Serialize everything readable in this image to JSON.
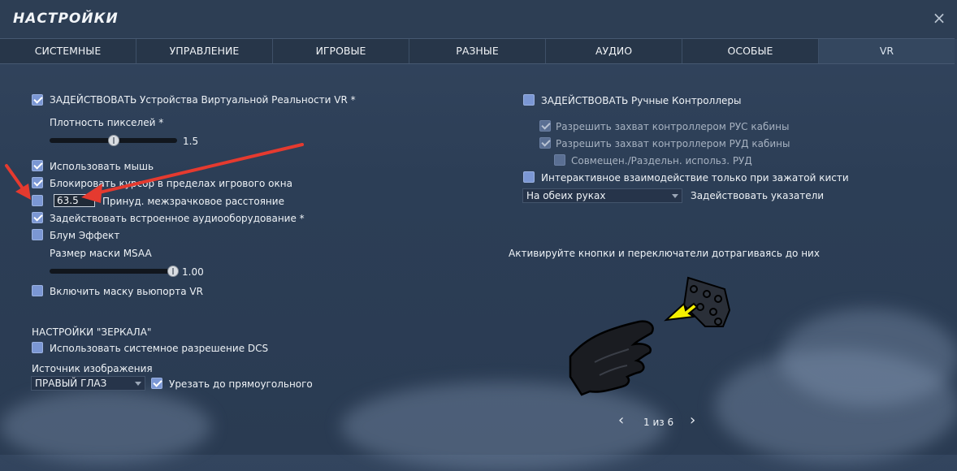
{
  "window": {
    "title": "НАСТРОЙКИ",
    "close_glyph": "×"
  },
  "tabs": [
    {
      "label": "СИСТЕМНЫЕ"
    },
    {
      "label": "УПРАВЛЕНИЕ"
    },
    {
      "label": "ИГРОВЫЕ"
    },
    {
      "label": "РАЗНЫЕ"
    },
    {
      "label": "АУДИО"
    },
    {
      "label": "ОСОБЫЕ"
    },
    {
      "label": "VR"
    }
  ],
  "active_tab": "VR",
  "left": {
    "enable_vr": {
      "label": "ЗАДЕЙСТВОВАТЬ Устройства Виртуальной Реальности VR *",
      "checked": true
    },
    "pixel_density": {
      "label": "Плотность пикселей *",
      "value": "1.5",
      "level": 0.5
    },
    "use_mouse": {
      "label": "Использовать мышь",
      "checked": true
    },
    "lock_cursor": {
      "label": "Блокировать курсор в пределах игрового окна",
      "checked": true
    },
    "ipd": {
      "value": "63.5",
      "label": "Принуд. межзрачковое расстояние",
      "checked": false
    },
    "builtin_audio": {
      "label": "Задействовать встроенное аудиооборудование *",
      "checked": true
    },
    "bloom": {
      "label": "Блум Эффект",
      "checked": false
    },
    "msaa": {
      "label": "Размер маски MSAA",
      "value": "1.00",
      "level": 1.0
    },
    "viewport_mask": {
      "label": "Включить маску вьюпорта VR",
      "checked": false
    },
    "mirror_header": "НАСТРОЙКИ \"ЗЕРКАЛА\"",
    "system_res": {
      "label": "Использовать системное разрешение DCS",
      "checked": false
    },
    "image_source": {
      "label": "Источник изображения",
      "value": "ПРАВЫЙ ГЛАЗ"
    },
    "crop_rect": {
      "label": "Урезать до прямоугольного",
      "checked": true
    }
  },
  "right": {
    "hand_controllers": {
      "label": "ЗАДЕЙСТВОВАТЬ Ручные Контроллеры",
      "checked": false
    },
    "stick_grab": {
      "label": "Разрешить захват контроллером РУС кабины",
      "checked": true
    },
    "throttle_grab": {
      "label": "Разрешить захват контроллером РУД кабины",
      "checked": true
    },
    "combined": {
      "label": "Совмещен./Раздельн. использ. РУД",
      "checked": false
    },
    "interactive_grip": {
      "label": "Интерактивное взаимодействие только при зажатой кисти",
      "checked": false
    },
    "hands_select": {
      "value": "На обеих руках",
      "label": "Задействовать указатели"
    },
    "tip_text": "Активируйте кнопки и переключатели дотрагиваясь до них",
    "pager": {
      "text": "1 из 6",
      "prev_glyph": "‹",
      "next_glyph": "›"
    }
  },
  "colors": {
    "background": "#2c3e56",
    "checkbox": "#7b97d4",
    "annotation_arrow": "#e53a2f",
    "illustration_arrow": "#f5f000"
  }
}
